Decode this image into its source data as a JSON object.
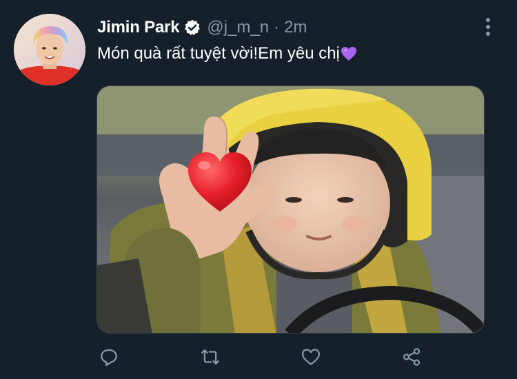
{
  "tweet": {
    "display_name": "Jimin Park",
    "verified": true,
    "handle": "@j_m_n",
    "separator": "·",
    "time": "2m",
    "text": "Món quà rất tuyệt vời!Em yêu chị",
    "text_emoji": "purple-heart",
    "media": {
      "type": "photo",
      "emoji_overlay": "red-heart"
    }
  },
  "actions": {
    "reply": "reply-icon",
    "retweet": "retweet-icon",
    "like": "like-icon",
    "share": "share-icon"
  },
  "colors": {
    "background": "#15202b",
    "text_primary": "#ffffff",
    "text_secondary": "#8899a6",
    "verified": "#ffffff",
    "purple_heart": "#aa66ee",
    "red_heart": "#e8202a"
  }
}
